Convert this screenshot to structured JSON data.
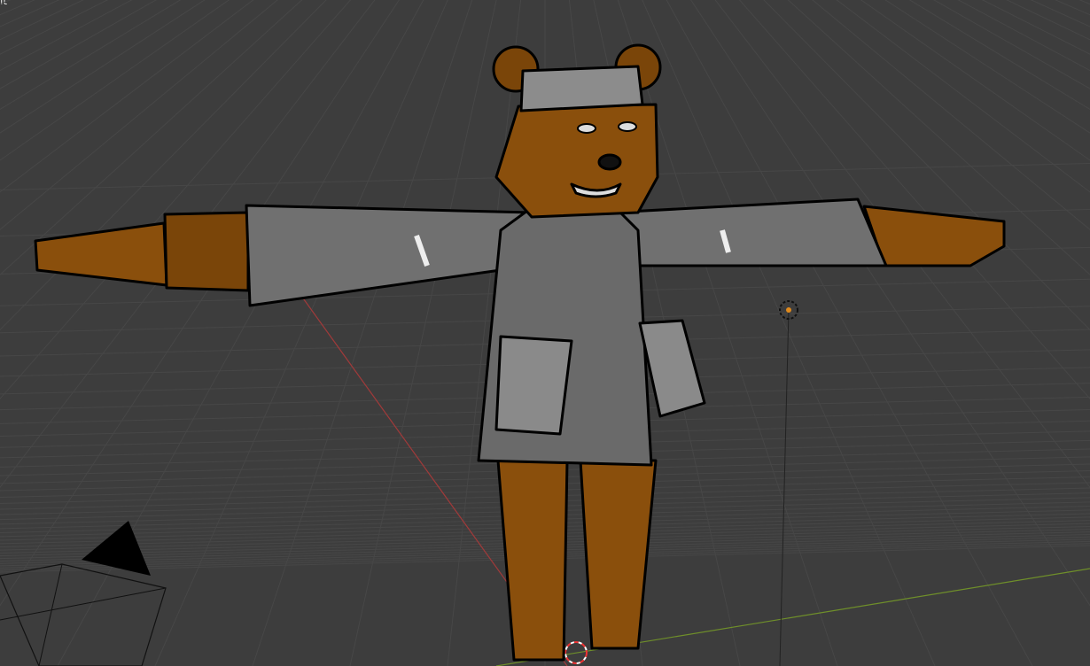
{
  "viewport": {
    "corner_label": "it",
    "mode": "3D Viewport"
  },
  "colors": {
    "background": "#3d3d3d",
    "grid": "#4a4a4a",
    "x_axis": "#a03a3a",
    "y_axis": "#6f8f2a",
    "fur": "#8a4f0c",
    "coat": "#6e6e6e"
  },
  "icons": [
    "camera-icon",
    "light-icon",
    "3d-cursor-icon"
  ]
}
